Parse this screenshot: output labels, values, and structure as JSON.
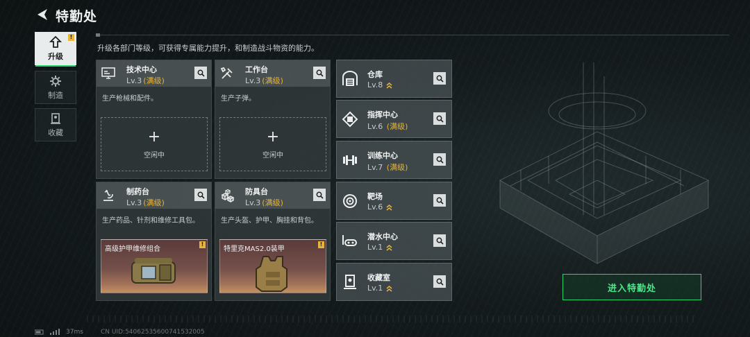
{
  "header": {
    "title": "特勤处",
    "subtitle": "升级各部门等级，可获得专属能力提升，和制造战斗物资的能力。"
  },
  "nav": [
    {
      "label": "升级",
      "active": true,
      "badge": "!"
    },
    {
      "label": "制造"
    },
    {
      "label": "收藏"
    }
  ],
  "cards": [
    {
      "name": "技术中心",
      "level": "Lv.3",
      "status": "(满级)",
      "desc": "生产枪械和配件。",
      "slot": {
        "plus": "+",
        "text": "空闲中"
      }
    },
    {
      "name": "工作台",
      "level": "Lv.3",
      "status": "(满级)",
      "desc": "生产子弹。",
      "slot": {
        "plus": "+",
        "text": "空闲中"
      }
    },
    {
      "name": "制药台",
      "level": "Lv.3",
      "status": "(满级)",
      "desc": "生产药品、针剂和维修工具包。",
      "item": {
        "name": "高级护甲维修组合",
        "badge": "!"
      }
    },
    {
      "name": "防具台",
      "level": "Lv.3",
      "status": "(满级)",
      "desc": "生产头盔、护甲、胸挂和背包。",
      "item": {
        "name": "特里克MAS2.0装甲",
        "badge": "!"
      }
    }
  ],
  "facilities": [
    {
      "name": "仓库",
      "level": "Lv.8",
      "status": ""
    },
    {
      "name": "指挥中心",
      "level": "Lv.6",
      "status": "(满级)"
    },
    {
      "name": "训练中心",
      "level": "Lv.7",
      "status": "(满级)"
    },
    {
      "name": "靶场",
      "level": "Lv.6",
      "status": ""
    },
    {
      "name": "潜水中心",
      "level": "Lv.1",
      "status": ""
    },
    {
      "name": "收藏室",
      "level": "Lv.1",
      "status": ""
    }
  ],
  "enter_button": "进入特勤处",
  "footer": {
    "ping": "37ms",
    "uid": "CN UID:5406253560074​1532005"
  },
  "colors": {
    "accent": "#2bd46e",
    "gold": "#e6b53a"
  }
}
